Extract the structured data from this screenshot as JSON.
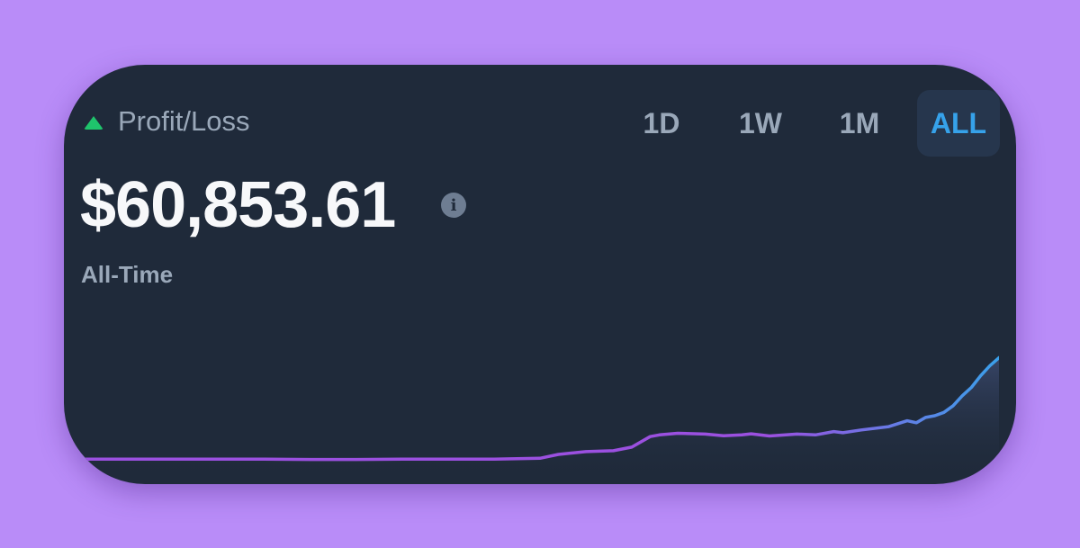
{
  "card": {
    "title": "Profit/Loss",
    "trend_icon": "triangle-up-icon",
    "value": "$60,853.61",
    "info_icon": "info-icon",
    "period_label": "All-Time"
  },
  "tabs": [
    {
      "label": "1D",
      "active": false
    },
    {
      "label": "1W",
      "active": false
    },
    {
      "label": "1M",
      "active": false
    },
    {
      "label": "ALL",
      "active": true
    }
  ],
  "colors": {
    "background": "#b98cf8",
    "card": "#1f2a3a",
    "up": "#1fc46c",
    "accent": "#36a2ea",
    "line_start": "#9b50e0",
    "line_end": "#3aa0ea"
  },
  "chart_data": {
    "type": "line",
    "x": [
      0,
      5,
      10,
      15,
      20,
      25,
      30,
      35,
      40,
      45,
      50,
      52,
      55,
      58,
      60,
      62,
      63,
      65,
      68,
      70,
      72,
      73,
      75,
      78,
      80,
      82,
      83,
      85,
      88,
      90,
      91,
      92,
      93,
      94,
      95,
      96,
      97,
      98,
      99,
      100
    ],
    "values": [
      0,
      0,
      0,
      0,
      0,
      -200,
      -200,
      0,
      0,
      0,
      500,
      2800,
      4500,
      5000,
      7200,
      13500,
      14500,
      15500,
      15000,
      14000,
      14500,
      15200,
      13900,
      15000,
      14500,
      16500,
      15800,
      17500,
      19500,
      23000,
      21800,
      25000,
      26000,
      28000,
      32000,
      38000,
      43000,
      50000,
      56000,
      60853.61
    ],
    "ylim": [
      -15000,
      80000
    ]
  }
}
